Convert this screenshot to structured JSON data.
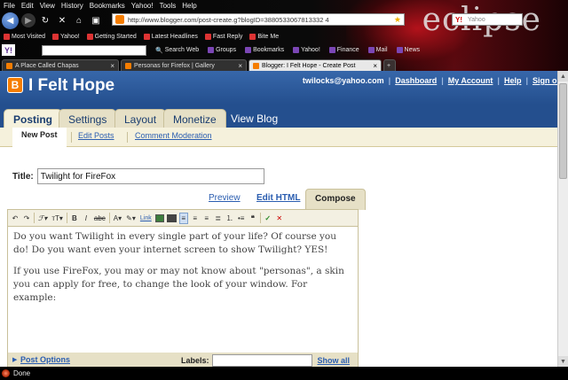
{
  "browser": {
    "menu": [
      "File",
      "Edit",
      "View",
      "History",
      "Bookmarks",
      "Yahoo!",
      "Tools",
      "Help"
    ],
    "theme_name": "eclipse",
    "url": "http://www.blogger.com/post-create.g?blogID=3880533067813332 4",
    "search_placeholder": "Yahoo",
    "bookmarks": [
      {
        "label": "Most Visited",
        "icon": "star-icon"
      },
      {
        "label": "Yahoo!",
        "icon": "yahoo-icon"
      },
      {
        "label": "Getting Started",
        "icon": "page-icon"
      },
      {
        "label": "Latest Headlines",
        "icon": "rss-icon"
      },
      {
        "label": "Fast Reply",
        "icon": "page-icon"
      },
      {
        "label": "Bite Me",
        "icon": "page-icon"
      }
    ],
    "yahoo_toolbar": {
      "search_web": "Search Web",
      "links": [
        "Groups",
        "Bookmarks",
        "Yahoo!",
        "Finance",
        "Mail",
        "News"
      ]
    },
    "tabs": [
      {
        "label": "A Place Called Chapas",
        "active": false
      },
      {
        "label": "Personas for Firefox | Gallery",
        "active": false
      },
      {
        "label": "Blogger: I Felt Hope - Create Post",
        "active": true
      }
    ],
    "status": "Done"
  },
  "blogger": {
    "logo_letter": "B",
    "blog_title": "I Felt Hope",
    "user_email": "twilocks@yahoo.com",
    "header_links": [
      "Dashboard",
      "My Account",
      "Help",
      "Sign out"
    ],
    "main_tabs": [
      "Posting",
      "Settings",
      "Layout",
      "Monetize"
    ],
    "view_blog": "View Blog",
    "sub_tabs": [
      "New Post",
      "Edit Posts",
      "Comment Moderation"
    ],
    "title_label": "Title:",
    "title_value": "Twilight for FireFox",
    "modes": {
      "preview": "Preview",
      "edit_html": "Edit HTML",
      "compose": "Compose"
    },
    "toolbar": {
      "link": "Link"
    },
    "body": [
      "Do you want Twilight in every single part of your life? Of course you do! Do you want even your internet screen to show Twilight? YES!",
      "If you use FireFox, you may or may not know about \"personas\", a skin you can apply for free, to change the look of your window. For example:"
    ],
    "post_options": "Post Options",
    "labels_label": "Labels:",
    "labels_value": "",
    "show_all": "Show all"
  }
}
